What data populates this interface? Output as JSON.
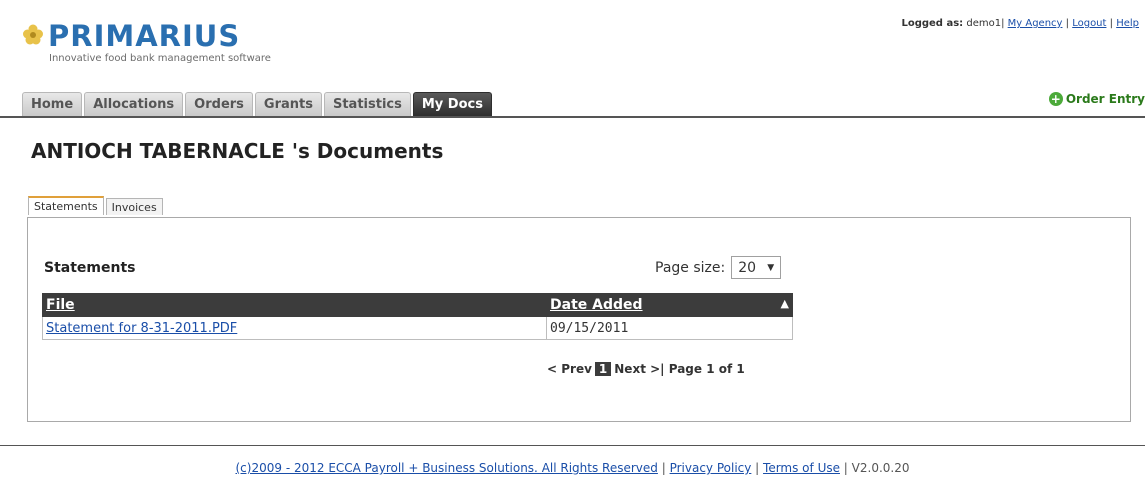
{
  "header": {
    "brand": "PRIMARIUS",
    "tagline": "Innovative food bank management software",
    "logged_as_label": "Logged as:",
    "username": "demo1",
    "links": [
      "My Agency",
      "Logout",
      "Help"
    ],
    "brand_color": "#2a6fb0"
  },
  "nav": {
    "tabs": [
      "Home",
      "Allocations",
      "Orders",
      "Grants",
      "Statistics",
      "My Docs"
    ],
    "active": "My Docs",
    "order_entry": "Order Entry",
    "order_entry_icon": "plus-circle-icon"
  },
  "page": {
    "title": "ANTIOCH TABERNACLE 's Documents"
  },
  "doc_tabs": [
    "Statements",
    "Invoices"
  ],
  "statements": {
    "title": "Statements",
    "page_size_label": "Page size:",
    "page_size_value": "20",
    "columns": [
      "File",
      "Date Added"
    ],
    "rows": [
      {
        "file": "Statement for 8-31-2011.PDF",
        "date": "09/15/2011"
      }
    ],
    "pager": {
      "prev": "< Prev",
      "current": "1",
      "next": "Next >|",
      "summary": "Page 1 of 1"
    }
  },
  "footer": {
    "copyright": "(c)2009 - 2012 ECCA Payroll + Business Solutions. All Rights Reserved",
    "privacy": "Privacy Policy",
    "terms": "Terms of Use",
    "version": "V2.0.0.20"
  }
}
